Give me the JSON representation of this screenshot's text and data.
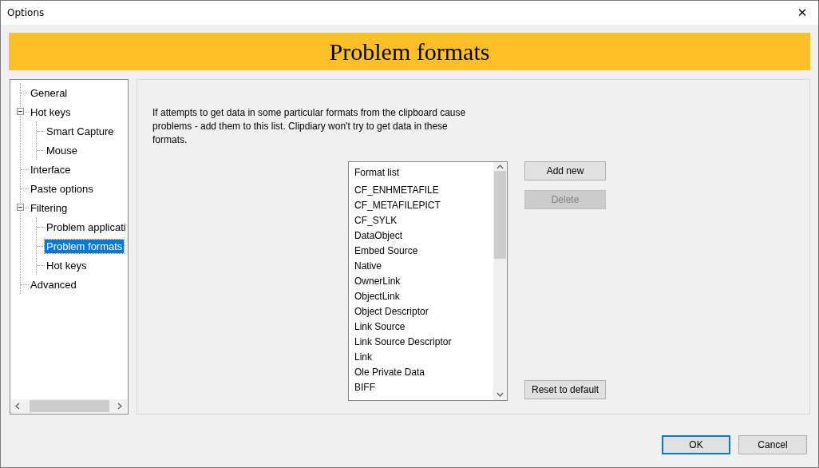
{
  "window": {
    "title": "Options",
    "close": "✕"
  },
  "header": {
    "title": "Problem formats"
  },
  "tree": [
    {
      "label": "General",
      "selected": false
    },
    {
      "label": "Hot keys",
      "selected": false,
      "expanded": true,
      "children": [
        {
          "label": "Smart Capture",
          "selected": false
        },
        {
          "label": "Mouse",
          "selected": false
        }
      ]
    },
    {
      "label": "Interface",
      "selected": false
    },
    {
      "label": "Paste options",
      "selected": false
    },
    {
      "label": "Filtering",
      "selected": false,
      "expanded": true,
      "children": [
        {
          "label": "Problem applicati",
          "selected": false
        },
        {
          "label": "Problem formats",
          "selected": true
        },
        {
          "label": "Hot keys",
          "selected": false
        }
      ]
    },
    {
      "label": "Advanced",
      "selected": false
    }
  ],
  "description": "If attempts to get data in some particular formats from the clipboard cause problems - add them to this list. Clipdiary won't try to get data in these formats.",
  "format_list": {
    "header": "Format list",
    "items": [
      "CF_ENHMETAFILE",
      "CF_METAFILEPICT",
      "CF_SYLK",
      "DataObject",
      "Embed Source",
      "Native",
      "OwnerLink",
      "ObjectLink",
      "Object Descriptor",
      "Link Source",
      "Link Source Descriptor",
      "Link",
      "Ole Private Data",
      "BIFF"
    ]
  },
  "side_buttons": [
    {
      "label": "Add new",
      "disabled": false
    },
    {
      "label": "Delete",
      "disabled": true
    }
  ],
  "reset_button": {
    "label": "Reset to default"
  },
  "footer_buttons": [
    {
      "label": "OK",
      "default": true
    },
    {
      "label": "Cancel",
      "default": false
    }
  ]
}
